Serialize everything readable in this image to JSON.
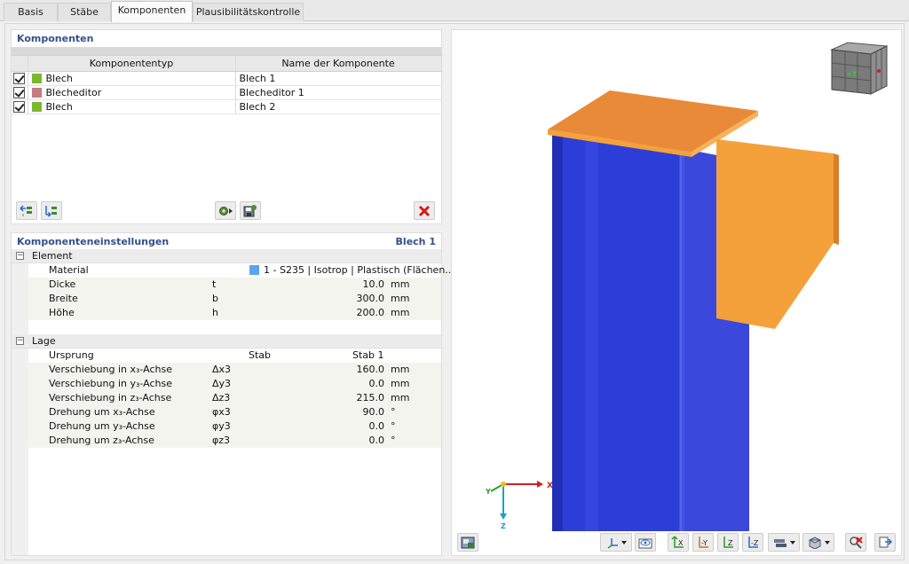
{
  "tabs": [
    {
      "label": "Basis",
      "active": false
    },
    {
      "label": "Stäbe",
      "active": false
    },
    {
      "label": "Komponenten",
      "active": true
    },
    {
      "label": "Plausibilitätskontrolle",
      "active": false
    }
  ],
  "components_panel": {
    "title": "Komponenten",
    "columns": [
      "Komponententyp",
      "Name der Komponente"
    ],
    "rows": [
      {
        "type": "Blech",
        "name": "Blech 1",
        "color": "#7cb82f",
        "checked": true
      },
      {
        "type": "Blecheditor",
        "name": "Blecheditor 1",
        "color": "#c47c7c",
        "checked": true
      },
      {
        "type": "Blech",
        "name": "Blech 2",
        "color": "#7cb82f",
        "checked": true
      }
    ],
    "toolbar_icons": [
      "move-up-icon",
      "move-down-icon",
      "gear-arrow-icon",
      "save-icon",
      "delete-icon"
    ]
  },
  "settings_panel": {
    "title": "Komponenteneinstellungen",
    "selected": "Blech 1",
    "element": {
      "label": "Element",
      "material_label": "Material",
      "material_value": "1 - S235 | Isotrop | Plastisch (Flächen...",
      "material_color": "#5aa6e8",
      "rows": [
        {
          "name": "Dicke",
          "symbol": "t",
          "value": "10.0",
          "unit": "mm"
        },
        {
          "name": "Breite",
          "symbol": "b",
          "value": "300.0",
          "unit": "mm"
        },
        {
          "name": "Höhe",
          "symbol": "h",
          "value": "200.0",
          "unit": "mm"
        }
      ]
    },
    "lage": {
      "label": "Lage",
      "origin_label": "Ursprung",
      "origin_value1": "Stab",
      "origin_value2": "Stab 1",
      "rows": [
        {
          "name": "Verschiebung in x₃-Achse",
          "symbol": "Δx3",
          "value": "160.0",
          "unit": "mm"
        },
        {
          "name": "Verschiebung in y₃-Achse",
          "symbol": "Δy3",
          "value": "0.0",
          "unit": "mm"
        },
        {
          "name": "Verschiebung in z₃-Achse",
          "symbol": "Δz3",
          "value": "215.0",
          "unit": "mm"
        },
        {
          "name": "Drehung um x₃-Achse",
          "symbol": "φx3",
          "value": "90.0",
          "unit": "°"
        },
        {
          "name": "Drehung um y₃-Achse",
          "symbol": "φy3",
          "value": "0.0",
          "unit": "°"
        },
        {
          "name": "Drehung um z₃-Achse",
          "symbol": "φz3",
          "value": "0.0",
          "unit": "°"
        }
      ]
    }
  },
  "viewer": {
    "axis_labels": {
      "x": "X",
      "y": "Y",
      "z": "Z"
    },
    "nav_cube_label": "+Y",
    "toolbar_icons": [
      "render-mode-icon",
      "axis-view-icon",
      "view-options-icon",
      "view-x-icon",
      "view-minus-y-icon",
      "view-z-icon",
      "view-minus-z-icon",
      "display-options-icon",
      "box-view-icon",
      "zoom-reset-icon",
      "exit-icon"
    ],
    "colors": {
      "column": "#2e3fd6",
      "plate": "#f4a13c",
      "plate_top": "#e8893a"
    }
  }
}
